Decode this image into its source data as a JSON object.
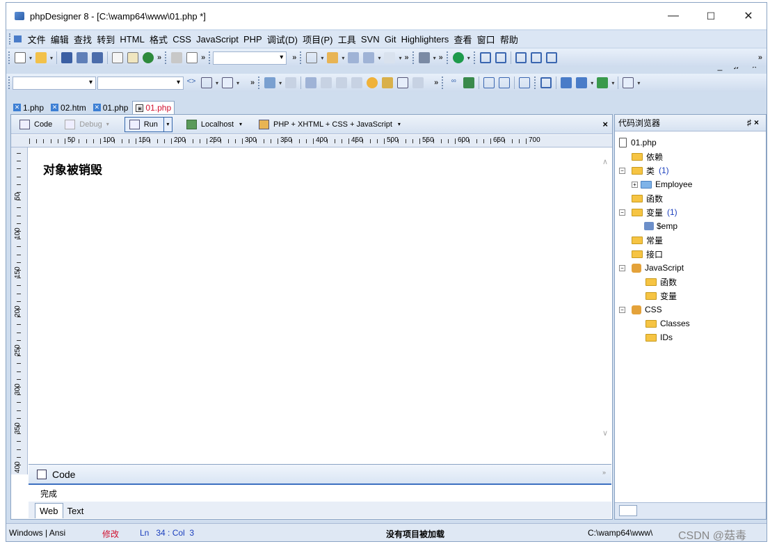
{
  "window": {
    "title": "phpDesigner 8 - [C:\\wamp64\\www\\01.php *]",
    "controls": {
      "minimize": "—",
      "maximize": "☐",
      "close": "✕"
    }
  },
  "menu": {
    "items": [
      "文件",
      "编辑",
      "查找",
      "转到",
      "HTML",
      "格式",
      "CSS",
      "JavaScript",
      "PHP",
      "调试(D)",
      "项目(P)",
      "工具",
      "SVN",
      "Git",
      "Highlighters",
      "查看",
      "窗口",
      "帮助"
    ],
    "mdi_controls": "_ ♬ ×"
  },
  "doc_tabs": [
    {
      "label": "1.php",
      "icon": "php-file-icon"
    },
    {
      "label": "02.htm",
      "icon": "html-file-icon"
    },
    {
      "label": "01.php",
      "icon": "php-file-icon"
    },
    {
      "label": "01.php",
      "icon": "preview-icon",
      "active": true
    }
  ],
  "editor_toolbar": {
    "code": "Code",
    "debug": "Debug",
    "run": "Run",
    "localhost": "Localhost",
    "doctype": "PHP + XHTML + CSS + JavaScript",
    "close": "×"
  },
  "ruler": {
    "h_labels": [
      "50",
      "100",
      "150",
      "200",
      "250",
      "300",
      "350",
      "400",
      "450",
      "500",
      "550",
      "600",
      "650",
      "700"
    ],
    "v_labels": [
      "50",
      "100",
      "150",
      "200",
      "250",
      "300",
      "350",
      "400"
    ]
  },
  "preview": {
    "text": "对象被销毁"
  },
  "code_bar": {
    "label": "Code",
    "chevron": "»"
  },
  "output": {
    "status": "完成"
  },
  "view_tabs": [
    {
      "label": "Web",
      "active": true
    },
    {
      "label": "Text"
    }
  ],
  "sidebar": {
    "title": "代码浏览器",
    "pin": "♯",
    "close": "×",
    "tree": [
      {
        "label": "01.php",
        "icon": "file-icon",
        "depth": 0
      },
      {
        "label": "依赖",
        "icon": "folder-icon",
        "depth": 1
      },
      {
        "label": "类",
        "icon": "folder-open-icon",
        "depth": 1,
        "count": "(1)",
        "expander": "−"
      },
      {
        "label": "Employee",
        "icon": "class-icon",
        "depth": 2,
        "expander": "+"
      },
      {
        "label": "函数",
        "icon": "folder-icon",
        "depth": 1
      },
      {
        "label": "变量",
        "icon": "folder-open-icon",
        "depth": 1,
        "count": "(1)",
        "expander": "−"
      },
      {
        "label": "$emp",
        "icon": "variable-icon",
        "depth": 2
      },
      {
        "label": "常量",
        "icon": "folder-icon",
        "depth": 1
      },
      {
        "label": "接口",
        "icon": "folder-icon",
        "depth": 1
      },
      {
        "label": "JavaScript",
        "icon": "js-group-icon",
        "depth": 1,
        "expander": "−"
      },
      {
        "label": "函数",
        "icon": "folder-icon",
        "depth": 2
      },
      {
        "label": "变量",
        "icon": "folder-icon",
        "depth": 2
      },
      {
        "label": "CSS",
        "icon": "css-group-icon",
        "depth": 1,
        "expander": "−"
      },
      {
        "label": "Classes",
        "icon": "folder-icon",
        "depth": 2
      },
      {
        "label": "IDs",
        "icon": "folder-icon",
        "depth": 2
      }
    ]
  },
  "statusbar": {
    "encoding": "Windows | Ansi",
    "modified": "修改",
    "position": "Ln   34 : Col  3",
    "project": "没有项目被加载",
    "path": "C:\\wamp64\\www\\",
    "watermark": "CSDN @菇毒"
  },
  "colors": {
    "accent": "#3c6fc0",
    "modified": "#d1102e",
    "count": "#1a3ebd"
  }
}
